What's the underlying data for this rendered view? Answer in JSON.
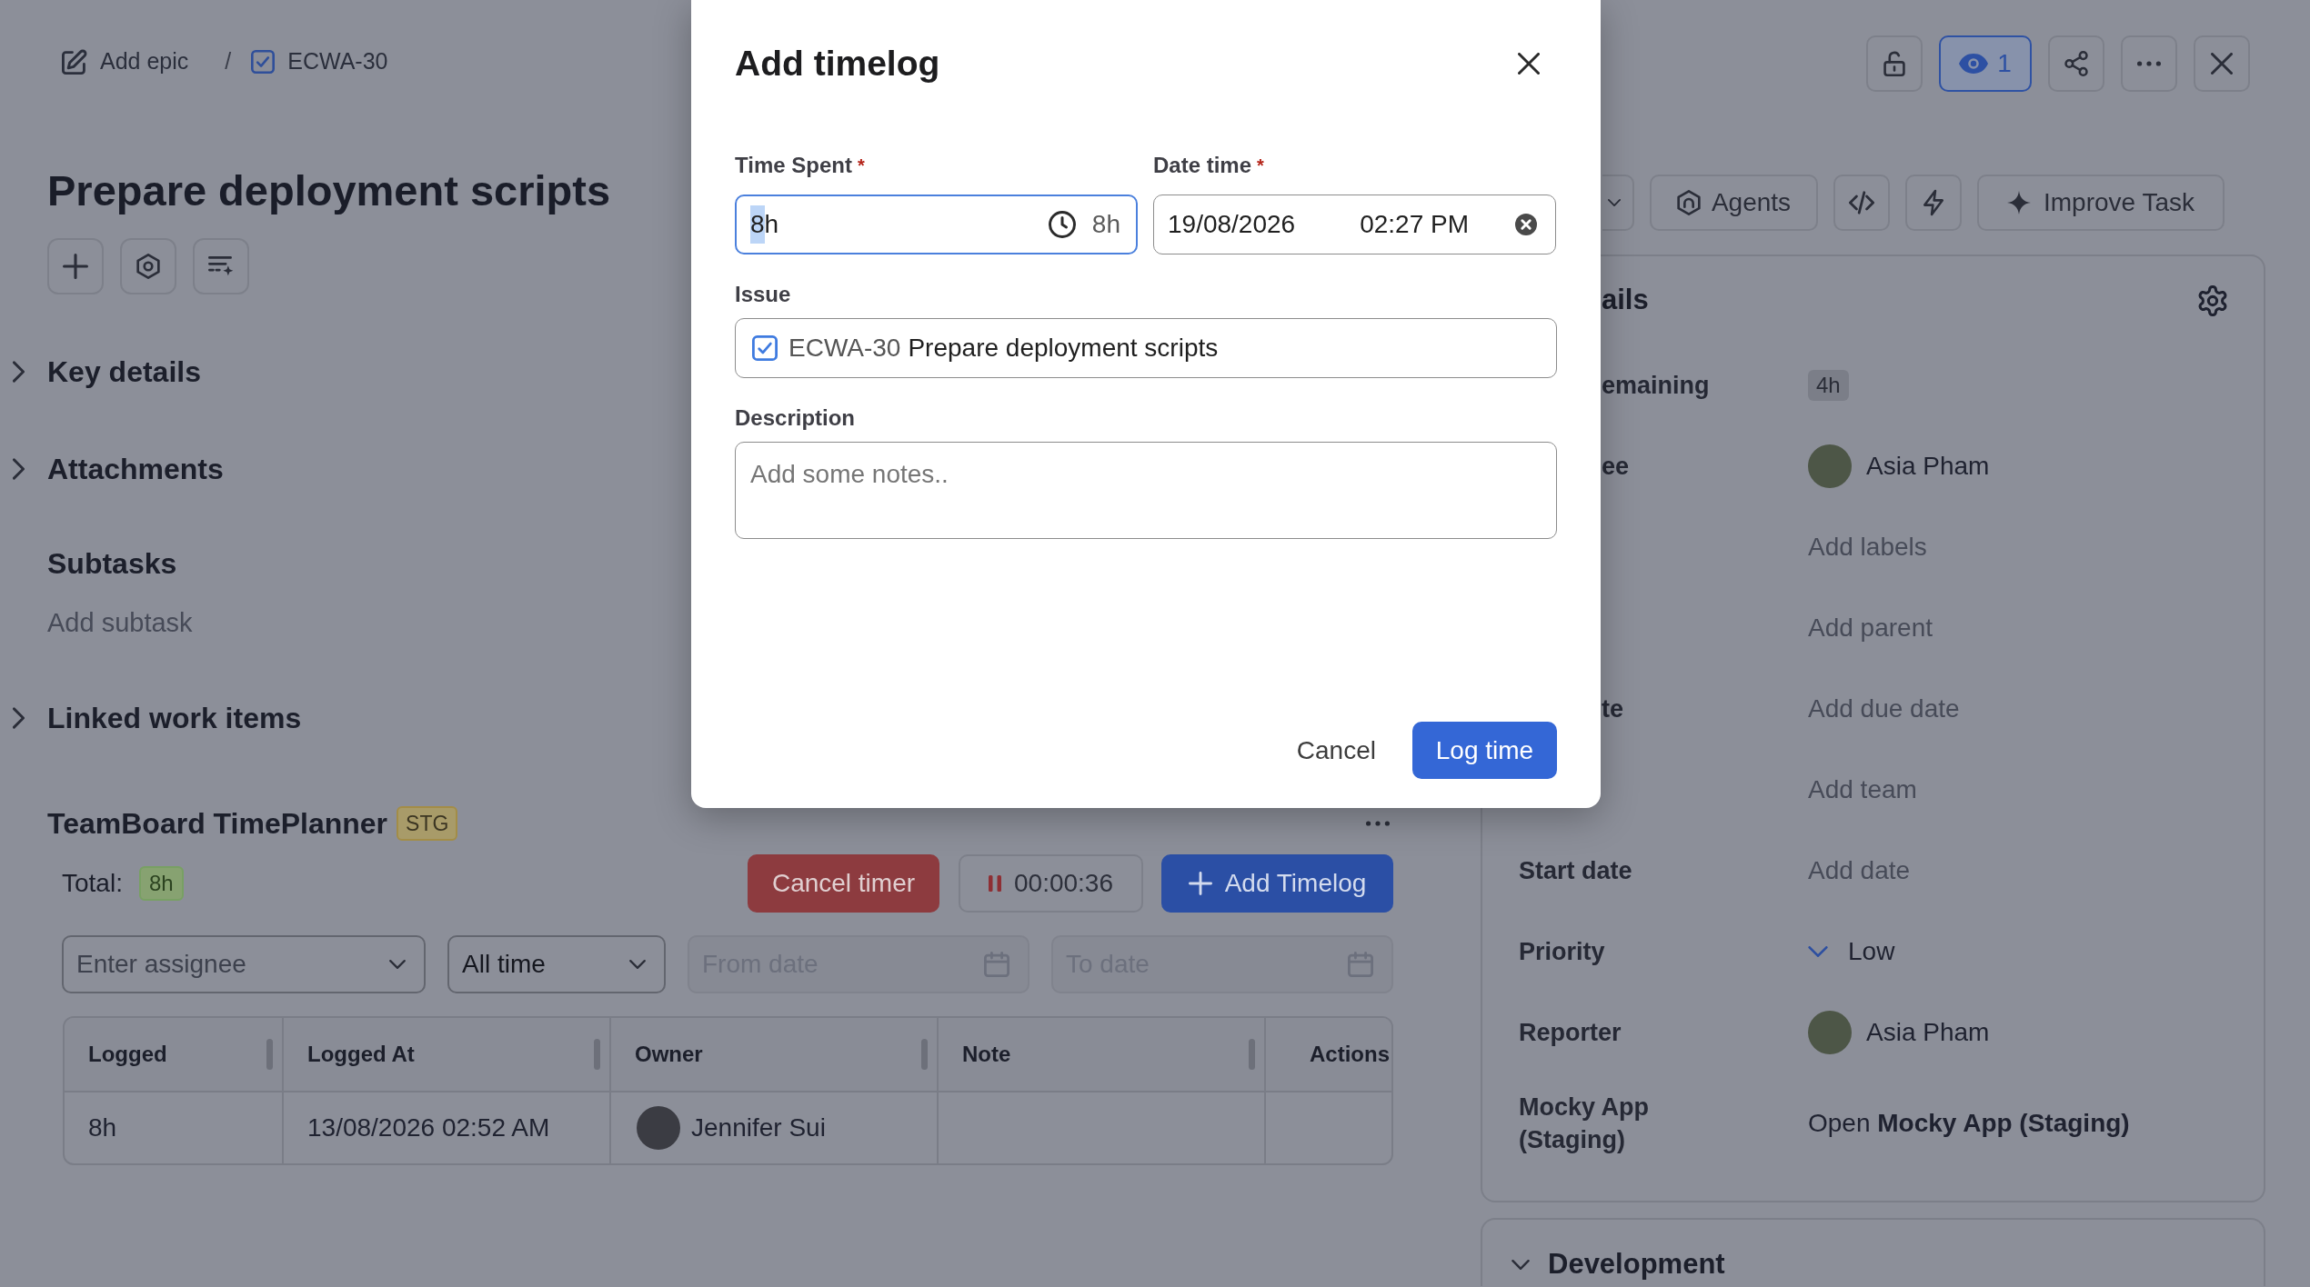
{
  "breadcrumb": {
    "items": [
      {
        "kind": "epic",
        "label": "Add epic"
      },
      {
        "kind": "task",
        "label": "ECWA-30"
      }
    ],
    "separator": "/"
  },
  "task": {
    "title": "Prepare deployment scripts"
  },
  "sections": [
    {
      "kind": "collapsible",
      "title": "Key details",
      "expanded": false
    },
    {
      "kind": "collapsible",
      "title": "Attachments",
      "expanded": false
    },
    {
      "kind": "list",
      "title": "Subtasks",
      "action": "Add subtask"
    },
    {
      "kind": "collapsible",
      "title": "Linked work items",
      "expanded": false
    }
  ],
  "timeplanner": {
    "title": "TeamBoard TimePlanner",
    "env": "STG",
    "total_label": "Total:",
    "total": "8h",
    "cancel_timer": "Cancel timer",
    "timer": {
      "running": true,
      "elapsed": "00:00:36"
    },
    "add_timelog": "Add Timelog",
    "filters": [
      {
        "kind": "select",
        "placeholder": "Enter assignee",
        "disabled": false
      },
      {
        "kind": "select",
        "value": "All time",
        "disabled": false
      },
      {
        "kind": "date",
        "placeholder": "From date",
        "disabled": true
      },
      {
        "kind": "date",
        "placeholder": "To date",
        "disabled": true
      }
    ],
    "table": {
      "columns": [
        {
          "label": "Logged",
          "resizable": true
        },
        {
          "label": "Logged At",
          "resizable": true
        },
        {
          "label": "Owner",
          "resizable": true
        },
        {
          "label": "Note",
          "resizable": true
        },
        {
          "label": "Actions",
          "resizable": false
        }
      ],
      "rows": [
        {
          "logged": "8h",
          "logged_at": "13/08/2026 02:52 AM",
          "owner": "Jennifer Sui"
        }
      ]
    }
  },
  "header_actions": {
    "watching": true,
    "watchers": "1"
  },
  "ai_toolbar": {
    "agents": "Agents",
    "improve": "Improve Task"
  },
  "details": {
    "title": "ails",
    "title_covered": true,
    "fields": [
      {
        "label": "emaining",
        "covered": true,
        "kind": "badge",
        "value": "4h"
      },
      {
        "label": "ee",
        "covered": true,
        "kind": "person",
        "value": "Asia Pham"
      },
      {
        "kind": "empty",
        "placeholder": "Add labels"
      },
      {
        "kind": "empty",
        "placeholder": "Add parent"
      },
      {
        "label": "te",
        "covered": true,
        "kind": "empty",
        "placeholder": "Add due date"
      },
      {
        "kind": "empty",
        "placeholder": "Add team"
      },
      {
        "label": "Start date",
        "kind": "empty",
        "placeholder": "Add date"
      },
      {
        "label": "Priority",
        "kind": "priority",
        "value": "Low"
      },
      {
        "label": "Reporter",
        "kind": "person",
        "value": "Asia Pham"
      },
      {
        "label": "Mocky App (Staging)",
        "kind": "link",
        "value": "Open **Mocky App (Staging)**"
      }
    ]
  },
  "development": {
    "title": "Development",
    "expanded": true
  },
  "modal": {
    "title": "Add timelog",
    "time_spent": {
      "label": "Time Spent",
      "marker": "*",
      "value": "8h",
      "focused": true,
      "preview": "8h"
    },
    "date_time": {
      "label": "Date time",
      "marker": "*",
      "date": "19/08/2026",
      "time": "02:27 PM"
    },
    "issue": {
      "label": "Issue",
      "key": "ECWA-30",
      "title": "Prepare deployment scripts"
    },
    "description": {
      "label": "Description",
      "placeholder": "Add some notes.."
    },
    "cancel": "Cancel",
    "submit": "Log time"
  }
}
